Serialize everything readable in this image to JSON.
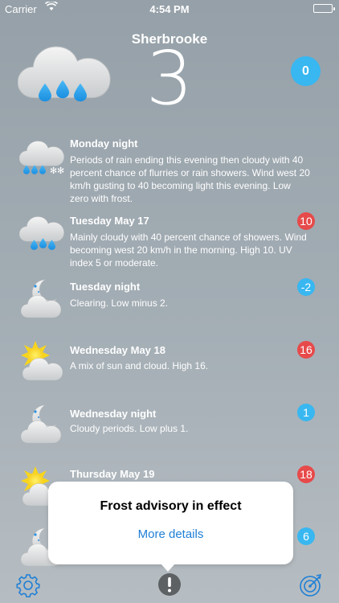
{
  "status_bar": {
    "carrier": "Carrier",
    "time": "4:54 PM"
  },
  "header": {
    "city": "Sherbrooke",
    "temperature": "3",
    "badge": "0",
    "icon": "cloud-rain-icon"
  },
  "forecast": [
    {
      "title": "Monday night",
      "text": "Periods of rain ending this evening then cloudy with 40 percent chance of flurries or rain showers. Wind west 20 km/h gusting to 40 becoming light this evening. Low zero with frost.",
      "badge": "",
      "icon": "cloud-rain-snow-icon"
    },
    {
      "title": "Tuesday May 17",
      "text": "Mainly cloudy with 40 percent chance of showers. Wind becoming west 20 km/h in the morning. High 10. UV index 5 or moderate.",
      "badge": "10",
      "badge_color": "#e74a4a",
      "icon": "cloud-rain-icon"
    },
    {
      "title": "Tuesday night",
      "text": "Clearing. Low minus 2.",
      "badge": "-2",
      "badge_color": "#38b7f0",
      "icon": "moon-cloud-icon"
    },
    {
      "title": "Wednesday May 18",
      "text": "A mix of sun and cloud. High 16.",
      "badge": "16",
      "badge_color": "#e74a4a",
      "icon": "sun-cloud-icon"
    },
    {
      "title": "Wednesday night",
      "text": "Cloudy periods. Low plus 1.",
      "badge": "1",
      "badge_color": "#38b7f0",
      "icon": "moon-cloud-icon"
    },
    {
      "title": "Thursday May 19",
      "text": "",
      "badge": "18",
      "badge_color": "#e74a4a",
      "icon": "sun-cloud-icon"
    },
    {
      "title": "",
      "text": "",
      "badge": "6",
      "badge_color": "#38b7f0",
      "icon": "moon-cloud-icon"
    }
  ],
  "popup": {
    "title": "Frost advisory in effect",
    "link": "More details"
  },
  "toolbar": {
    "settings_icon": "gear-icon",
    "alert_icon": "exclamation-icon",
    "radar_icon": "radar-icon"
  },
  "colors": {
    "badge_blue": "#38b7f0",
    "badge_red": "#e74a4a",
    "link_blue": "#1f7fd6"
  }
}
